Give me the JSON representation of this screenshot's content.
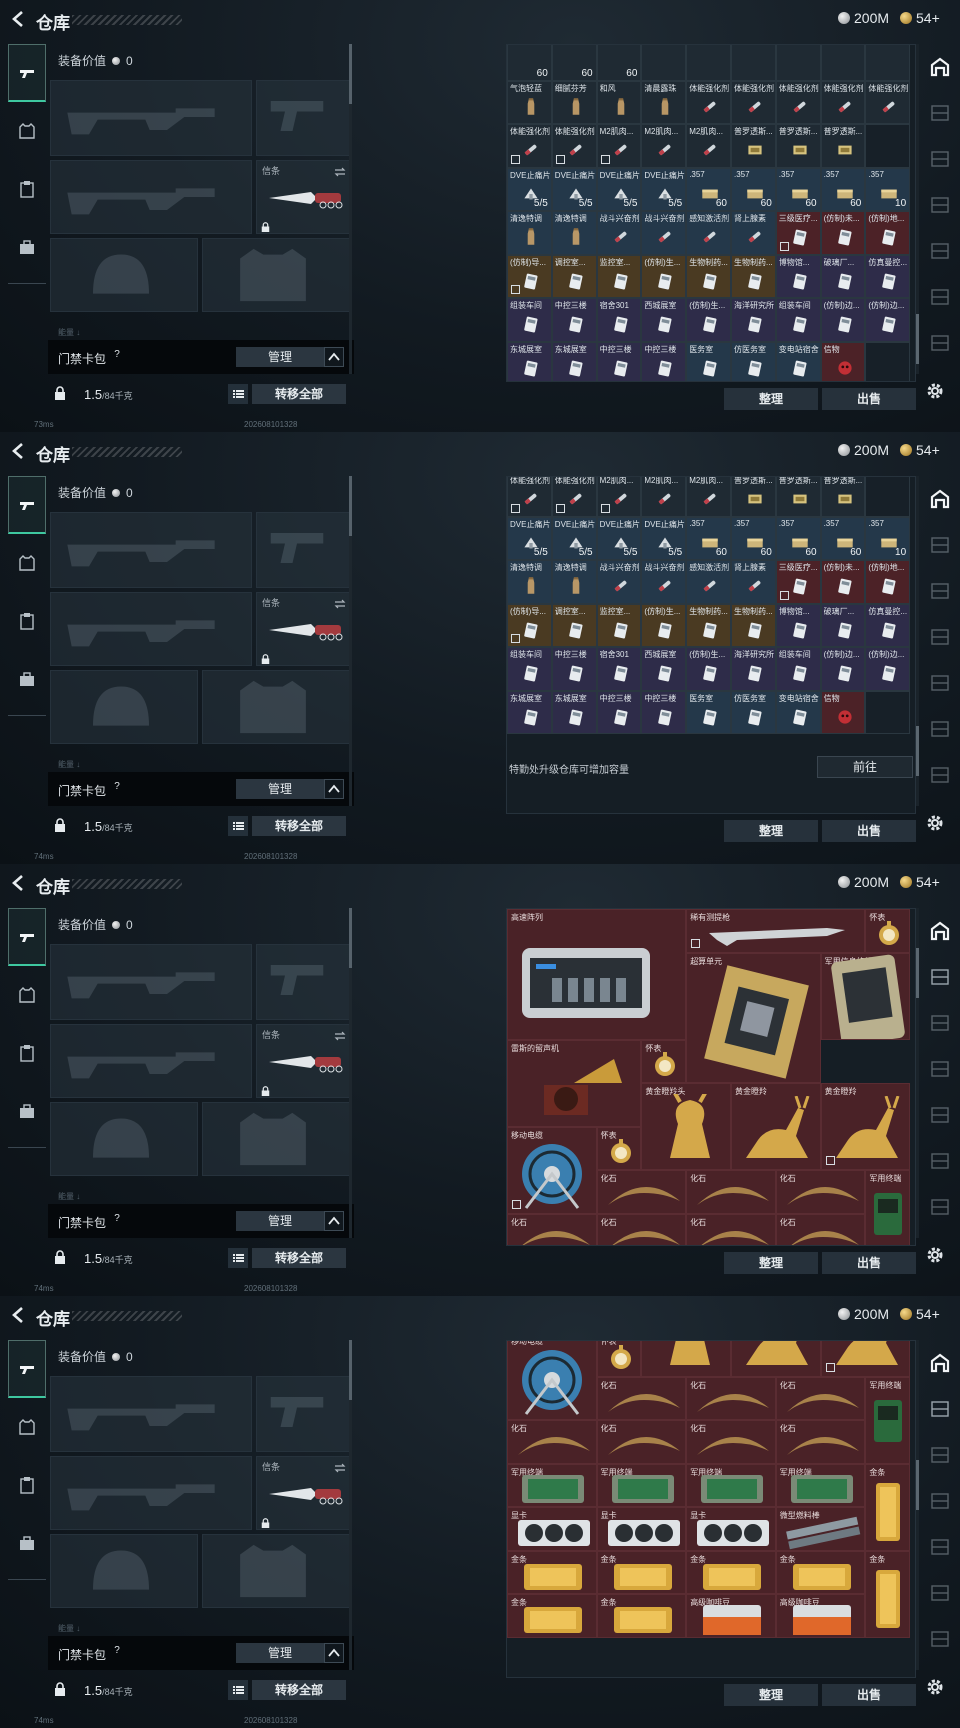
{
  "header": {
    "title": "仓库",
    "silver": "200M",
    "gold": "54+"
  },
  "loadout": {
    "equip_value_label": "装备价值",
    "equip_value": "0",
    "knife_label": "信条",
    "keycard_label": "门禁卡包",
    "help": "?",
    "manage_label": "管理",
    "weight_value": "1.5",
    "weight_capacity": "/84千克",
    "transfer_all_label": "转移全部",
    "sep_text": "能量 ↓"
  },
  "stash": {
    "sort_label": "整理",
    "sell_label": "出售",
    "upgrade_text": "特勤处升级仓库可增加容量",
    "goto_label": "前往"
  },
  "status": {
    "panel1_ping": "73ms",
    "panel_ping": "74ms",
    "timestamp": "2026081013​28"
  },
  "panel1_rows": [
    [
      {
        "l": "",
        "c": "60",
        "t": "gray"
      },
      {
        "l": "",
        "c": "60",
        "t": "gray"
      },
      {
        "l": "",
        "c": "60",
        "t": "gray"
      },
      {
        "l": "",
        "c": "",
        "t": "gray"
      },
      {
        "l": "",
        "c": "",
        "t": "gray"
      },
      {
        "l": "",
        "c": "",
        "t": "gray"
      },
      {
        "l": "",
        "c": "",
        "t": "gray"
      },
      {
        "l": "",
        "c": "",
        "t": "gray"
      },
      {
        "l": "",
        "c": "",
        "t": "gray"
      }
    ],
    [
      {
        "l": "气泡轻蓝",
        "c": "",
        "t": "gray"
      },
      {
        "l": "细腻芬芳",
        "c": "",
        "t": "gray"
      },
      {
        "l": "和风",
        "c": "",
        "t": "gray"
      },
      {
        "l": "清晨露珠",
        "c": "",
        "t": "gray"
      },
      {
        "l": "体能强化剂",
        "c": "",
        "t": "gray"
      },
      {
        "l": "体能强化剂",
        "c": "",
        "t": "gray"
      },
      {
        "l": "体能强化剂",
        "c": "",
        "t": "gray"
      },
      {
        "l": "体能强化剂",
        "c": "",
        "t": "gray"
      },
      {
        "l": "体能强化剂",
        "c": "",
        "t": "gray"
      }
    ],
    [
      {
        "l": "体能强化剂",
        "c": "",
        "t": "gray",
        "m": 1
      },
      {
        "l": "体能强化剂",
        "c": "",
        "t": "gray",
        "m": 1
      },
      {
        "l": "M2肌肉...",
        "c": "",
        "t": "gray",
        "m": 1
      },
      {
        "l": "M2肌肉...",
        "c": "",
        "t": "gray"
      },
      {
        "l": "M2肌肉...",
        "c": "",
        "t": "gray"
      },
      {
        "l": "普罗透斯...",
        "c": "",
        "t": "gray"
      },
      {
        "l": "普罗透斯...",
        "c": "",
        "t": "gray"
      },
      {
        "l": "普罗透斯...",
        "c": "",
        "t": "gray"
      },
      {
        "l": "",
        "c": "",
        "t": "empty"
      }
    ],
    [
      {
        "l": "DVE止痛片",
        "c": "5/5",
        "t": "blue"
      },
      {
        "l": "DVE止痛片",
        "c": "5/5",
        "t": "blue"
      },
      {
        "l": "DVE止痛片",
        "c": "5/5",
        "t": "blue"
      },
      {
        "l": "DVE止痛片",
        "c": "5/5",
        "t": "blue"
      },
      {
        "l": ".357",
        "c": "60",
        "t": "blue"
      },
      {
        "l": ".357",
        "c": "60",
        "t": "blue"
      },
      {
        "l": ".357",
        "c": "60",
        "t": "blue"
      },
      {
        "l": ".357",
        "c": "60",
        "t": "blue"
      },
      {
        "l": ".357",
        "c": "10",
        "t": "blue"
      }
    ],
    [
      {
        "l": "清逸特调",
        "c": "",
        "t": "blue"
      },
      {
        "l": "清逸特调",
        "c": "",
        "t": "blue"
      },
      {
        "l": "战斗兴奋剂",
        "c": "",
        "t": "blue"
      },
      {
        "l": "战斗兴奋剂",
        "c": "",
        "t": "blue"
      },
      {
        "l": "感知激活剂",
        "c": "",
        "t": "blue"
      },
      {
        "l": "肾上腺素",
        "c": "",
        "t": "blue"
      },
      {
        "l": "三级医疗...",
        "c": "",
        "t": "red",
        "m": 1
      },
      {
        "l": "(仿制)未...",
        "c": "",
        "t": "red"
      },
      {
        "l": "(仿制)地...",
        "c": "",
        "t": "red"
      }
    ],
    [
      {
        "l": "(仿制)导...",
        "c": "",
        "t": "gold",
        "m": 1
      },
      {
        "l": "调控室...",
        "c": "",
        "t": "gold"
      },
      {
        "l": "监控室...",
        "c": "",
        "t": "gold"
      },
      {
        "l": "(仿制)生...",
        "c": "",
        "t": "gold"
      },
      {
        "l": "生物制药...",
        "c": "",
        "t": "gold"
      },
      {
        "l": "生物制药...",
        "c": "",
        "t": "gold"
      },
      {
        "l": "博物馆...",
        "c": "",
        "t": "purple"
      },
      {
        "l": "破璃厂...",
        "c": "",
        "t": "purple"
      },
      {
        "l": "仿真曼控...",
        "c": "",
        "t": "purple"
      }
    ],
    [
      {
        "l": "组装车间",
        "c": "",
        "t": "purple"
      },
      {
        "l": "中控三楼",
        "c": "",
        "t": "purple"
      },
      {
        "l": "宿舍301",
        "c": "",
        "t": "purple"
      },
      {
        "l": "西城展室",
        "c": "",
        "t": "purple"
      },
      {
        "l": "(仿制)生...",
        "c": "",
        "t": "purple"
      },
      {
        "l": "海洋研究所",
        "c": "",
        "t": "purple"
      },
      {
        "l": "组装车间",
        "c": "",
        "t": "purple"
      },
      {
        "l": "(仿制)边...",
        "c": "",
        "t": "purple"
      },
      {
        "l": "(仿制)边...",
        "c": "",
        "t": "purple"
      }
    ],
    [
      {
        "l": "东城展室",
        "c": "",
        "t": "purple"
      },
      {
        "l": "东城展室",
        "c": "",
        "t": "purple"
      },
      {
        "l": "中控三楼",
        "c": "",
        "t": "purple"
      },
      {
        "l": "中控三楼",
        "c": "",
        "t": "purple"
      },
      {
        "l": "医务室",
        "c": "",
        "t": "blue"
      },
      {
        "l": "仿医务室",
        "c": "",
        "t": "blue"
      },
      {
        "l": "变电站宿舍",
        "c": "",
        "t": "blue"
      },
      {
        "l": "信物",
        "c": "",
        "t": "red"
      },
      {
        "l": "",
        "c": "",
        "t": "empty"
      }
    ]
  ],
  "panel3_items": [
    {
      "label": "高速阵列"
    },
    {
      "label": "稀有测提枪"
    },
    {
      "label": "怀表"
    },
    {
      "label": "超算单元"
    },
    {
      "label": "军用信息终端"
    },
    {
      "label": "雷斯的留声机"
    },
    {
      "label": "怀表"
    },
    {
      "label": "黄金瞪羚头"
    },
    {
      "label": "黄金瞪羚"
    },
    {
      "label": "黄金瞪羚"
    },
    {
      "label": "移动电缆"
    },
    {
      "label": "怀表"
    },
    {
      "label": "化石"
    },
    {
      "label": "军用终端"
    }
  ],
  "panel4_items": [
    {
      "label": "移动电缆"
    },
    {
      "label": "怀表"
    },
    {
      "label": "化石"
    },
    {
      "label": "军用终端"
    },
    {
      "label": "军用终端"
    },
    {
      "label": "金条"
    },
    {
      "label": "显卡"
    },
    {
      "label": "微型燃料棒"
    },
    {
      "label": "金条"
    },
    {
      "label": "高级咖啡豆"
    }
  ]
}
